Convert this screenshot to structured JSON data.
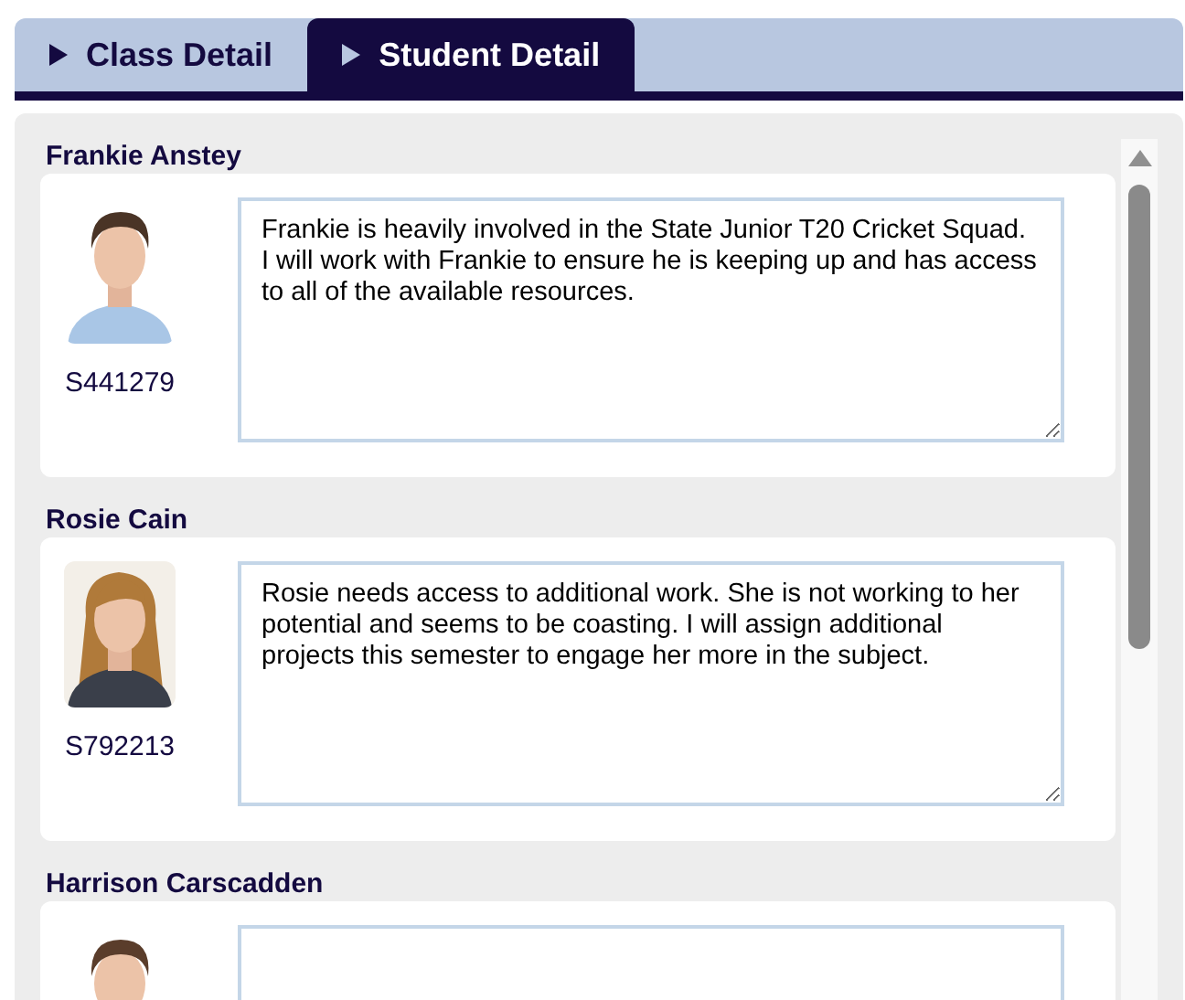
{
  "tabs": [
    {
      "label": "Class Detail",
      "selected": false
    },
    {
      "label": "Student Detail",
      "selected": true
    }
  ],
  "students": [
    {
      "name": "Frankie Anstey",
      "id": "S441279",
      "comment": "Frankie is heavily involved in the State Junior T20 Cricket Squad. I will work with Frankie to ensure he is keeping up and has access to all of the available resources."
    },
    {
      "name": "Rosie Cain",
      "id": "S792213",
      "comment": "Rosie needs access to additional work. She is not working to her potential and seems to be coasting. I will assign additional projects this semester to engage her more in the subject."
    },
    {
      "name": "Harrison Carscadden"
    }
  ]
}
